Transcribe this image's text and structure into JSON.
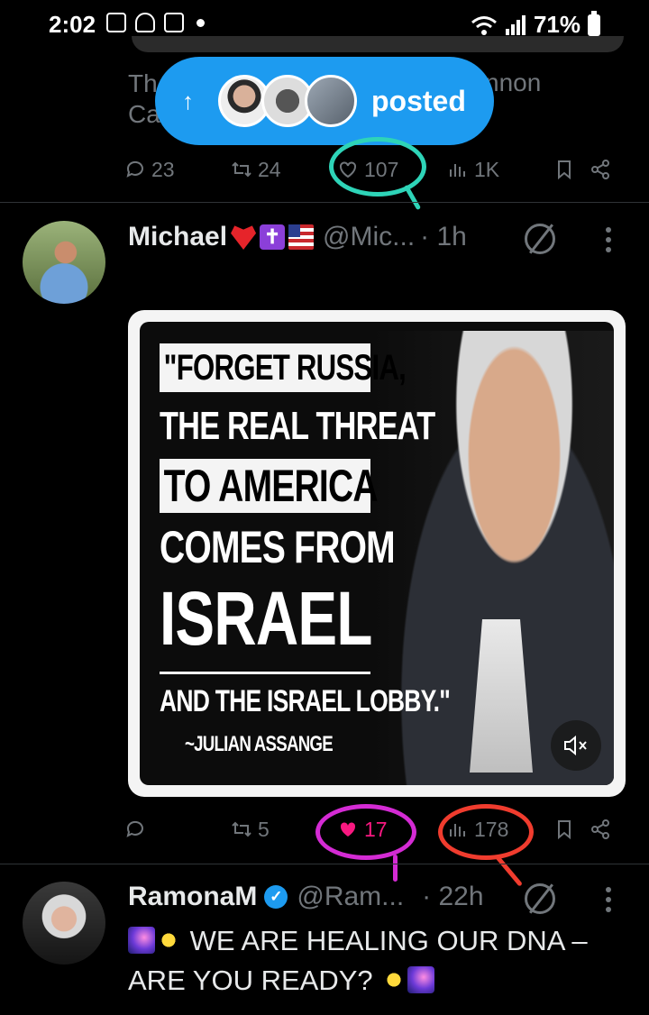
{
  "status_bar": {
    "time": "2:02",
    "battery": "71%",
    "icons": [
      "gallery-icon",
      "person-add-icon",
      "calendar-icon",
      "dot-icon",
      "wifi-icon",
      "signal-icon",
      "battery-icon"
    ]
  },
  "previous_tweet": {
    "text_start": "Th",
    "text_start2": "Ca",
    "text_end": "nnon",
    "stats": {
      "replies": "23",
      "reposts": "24",
      "likes": "107",
      "views": "1K"
    }
  },
  "new_posts_pill": {
    "arrow": "↑",
    "label": "posted"
  },
  "tweet1": {
    "name": "Michael",
    "handle": "@Mic...",
    "time": "· 1h",
    "media": {
      "line1": "\"FORGET RUSSIA,",
      "line2": "THE REAL THREAT",
      "line3": "TO AMERICA",
      "line4": "COMES FROM",
      "line5": "ISRAEL",
      "line6": "AND THE ISRAEL LOBBY.\"",
      "line7": "~JULIAN ASSANGE"
    },
    "stats": {
      "replies": "",
      "reposts": "5",
      "likes": "17",
      "views": "178"
    }
  },
  "tweet2": {
    "name": "RamonaM",
    "handle": "@Ram...",
    "time": "· 22h",
    "text": "WE ARE HEALING OUR DNA – ARE YOU READY?"
  },
  "colors": {
    "accent": "#1d9bf0",
    "like_active": "#f91880",
    "annotation_teal": "#2ed4b8",
    "annotation_purple": "#d42bd4",
    "annotation_red": "#f03c2e"
  }
}
